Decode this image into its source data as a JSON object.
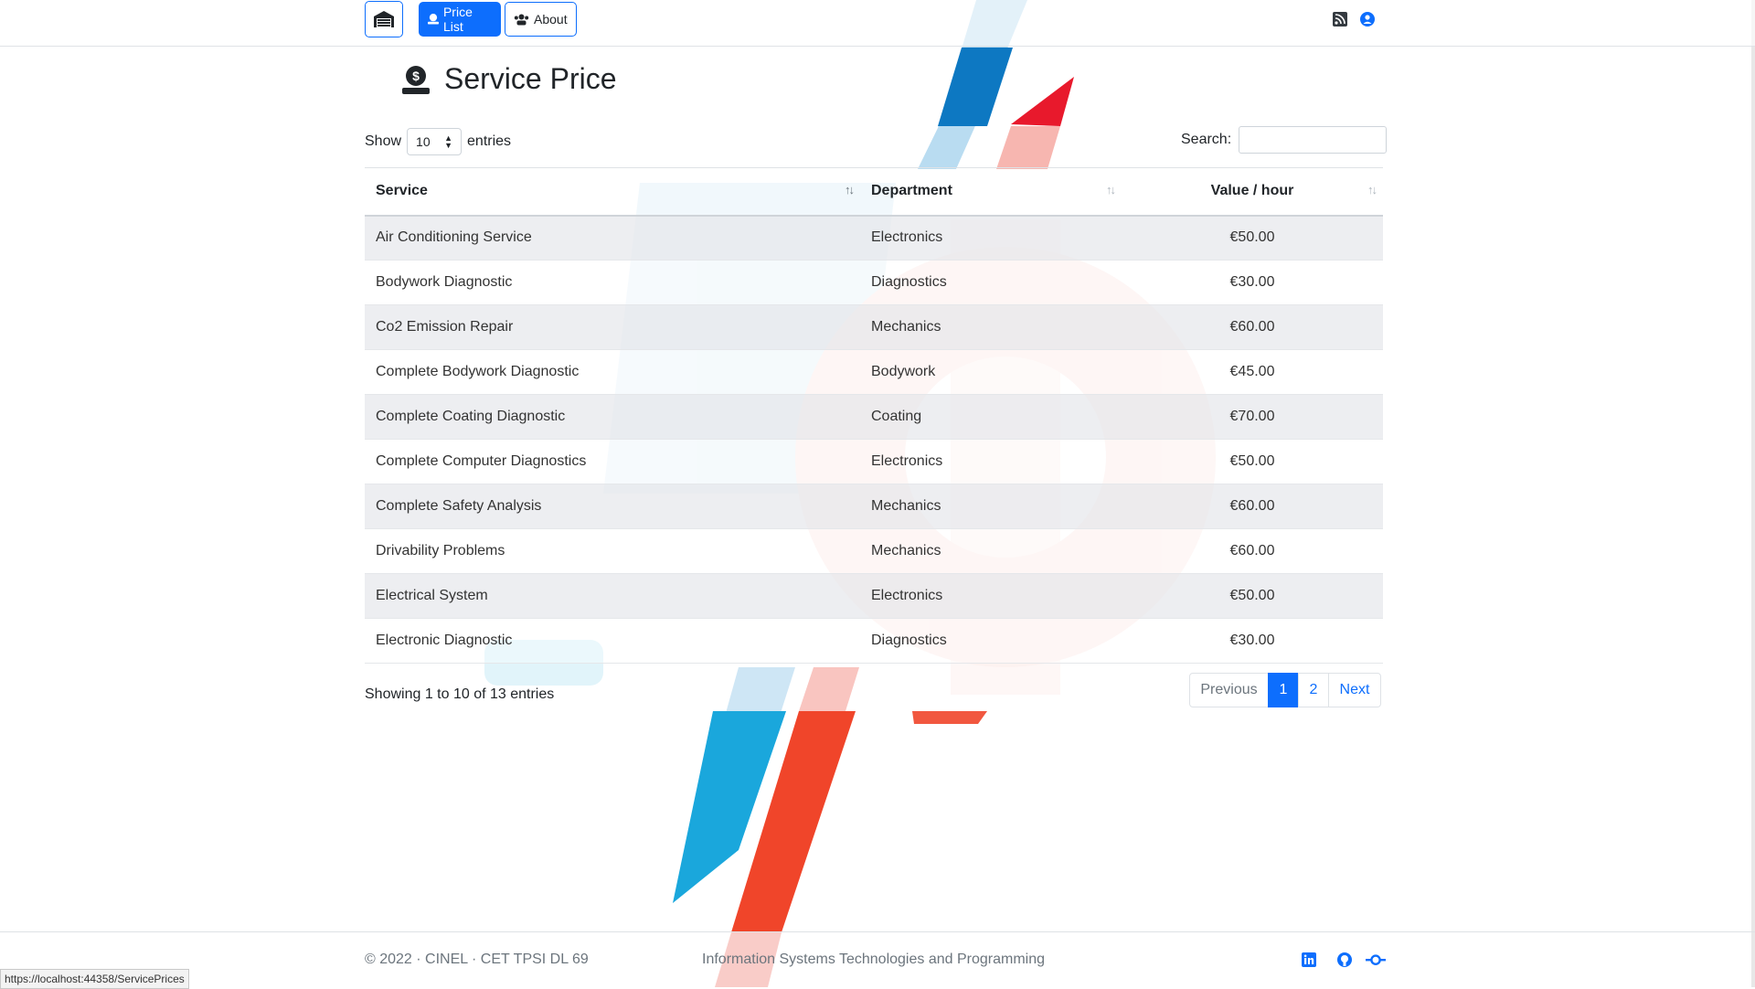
{
  "nav": {
    "brand_icon": "garage-icon",
    "price_list_label": "Price List",
    "about_label": "About",
    "right_icons": [
      "rss-icon",
      "user-circle-icon"
    ]
  },
  "header": {
    "title": "Service Price",
    "icon": "money-hand-icon"
  },
  "controls": {
    "show_label": "Show",
    "page_size": "10",
    "entries_label": "entries",
    "search_label": "Search:",
    "search_value": ""
  },
  "table": {
    "columns": [
      "Service",
      "Department",
      "Value / hour"
    ],
    "rows": [
      {
        "service": "Air Conditioning Service",
        "department": "Electronics",
        "value": "€50.00"
      },
      {
        "service": "Bodywork Diagnostic",
        "department": "Diagnostics",
        "value": "€30.00"
      },
      {
        "service": "Co2 Emission Repair",
        "department": "Mechanics",
        "value": "€60.00"
      },
      {
        "service": "Complete Bodywork Diagnostic",
        "department": "Bodywork",
        "value": "€45.00"
      },
      {
        "service": "Complete Coating Diagnostic",
        "department": "Coating",
        "value": "€70.00"
      },
      {
        "service": "Complete Computer Diagnostics",
        "department": "Electronics",
        "value": "€50.00"
      },
      {
        "service": "Complete Safety Analysis",
        "department": "Mechanics",
        "value": "€60.00"
      },
      {
        "service": "Drivability Problems",
        "department": "Mechanics",
        "value": "€60.00"
      },
      {
        "service": "Electrical System",
        "department": "Electronics",
        "value": "€50.00"
      },
      {
        "service": "Electronic Diagnostic",
        "department": "Diagnostics",
        "value": "€30.00"
      }
    ]
  },
  "info_text": "Showing 1 to 10 of 13 entries",
  "pagination": {
    "previous": "Previous",
    "pages": [
      "1",
      "2"
    ],
    "current": "1",
    "next": "Next"
  },
  "footer": {
    "copyright": "© 2022 · CINEL · CET TPSI DL 69",
    "center_text": "Information Systems Technologies and Programming",
    "social_icons": [
      "linkedin-icon",
      "github-icon",
      "git-commit-icon"
    ]
  },
  "status_url": "https://localhost:44358/ServicePrices",
  "colors": {
    "primary": "#0d6efd",
    "brand_blue": "#1aa7dc",
    "brand_red": "#f0452a"
  }
}
